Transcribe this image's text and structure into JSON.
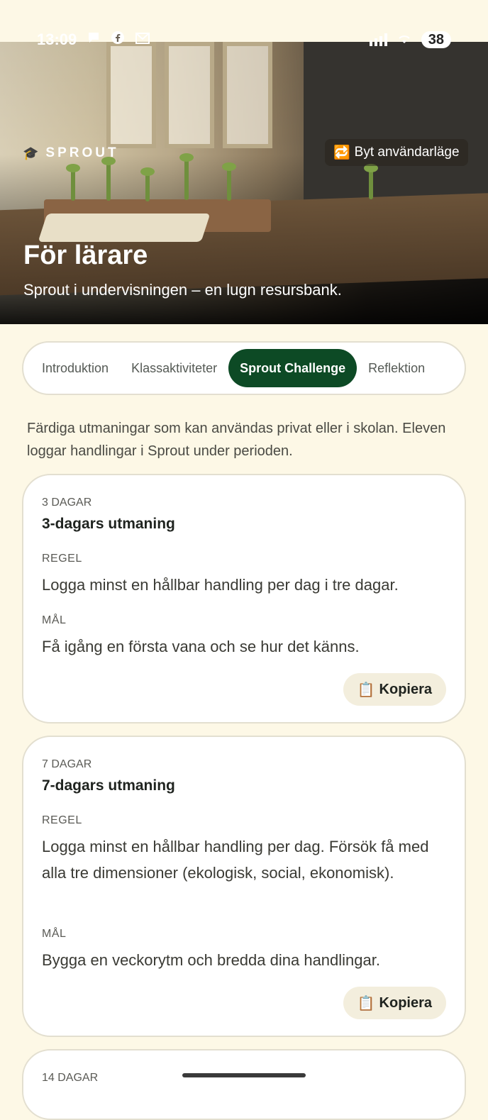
{
  "status_bar": {
    "time": "13:09",
    "battery": "38"
  },
  "hero": {
    "brand": "SPROUT",
    "mode_switch": "Byt användarläge",
    "title": "För lärare",
    "subtitle": "Sprout i undervisningen – en lugn resursbank."
  },
  "tabs": [
    {
      "label": "Introduktion",
      "active": false
    },
    {
      "label": "Klassaktiviteter",
      "active": false
    },
    {
      "label": "Sprout Challenge",
      "active": true
    },
    {
      "label": "Reflektion",
      "active": false
    }
  ],
  "intro": "Färdiga utmaningar som kan användas privat eller i skolan. Eleven loggar handlingar i Sprout under perioden.",
  "cards": [
    {
      "tag": "3 DAGAR",
      "title": "3-dagars utmaning",
      "rule_label": "REGEL",
      "rule": "Logga minst en hållbar handling per dag i tre dagar.",
      "goal_label": "MÅL",
      "goal": "Få igång en första vana och se hur det känns.",
      "copy": "Kopiera"
    },
    {
      "tag": "7 DAGAR",
      "title": "7-dagars utmaning",
      "rule_label": "REGEL",
      "rule": "Logga minst en hållbar handling per dag. Försök få med alla tre dimensioner (ekologisk, social, ekonomisk).",
      "goal_label": "MÅL",
      "goal": "Bygga en veckorytm och bredda dina handlingar.",
      "copy": "Kopiera"
    },
    {
      "tag": "14 DAGAR"
    }
  ]
}
